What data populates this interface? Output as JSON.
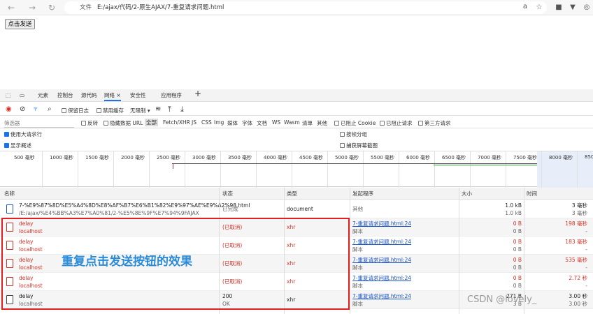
{
  "browser": {
    "file_label": "文件",
    "url": "E:/ajax/代码/2-原生AJAX/7-重复请求问题.html"
  },
  "page": {
    "send_button": "点击发送"
  },
  "devtools": {
    "tabs": [
      "元素",
      "控制台",
      "源代码",
      "网络",
      "安全性",
      "应用程序"
    ],
    "active_tab": "网络",
    "toolbar": {
      "preserve_log": "保留日志",
      "disable_cache": "禁用缓存",
      "throttle": "无限制"
    },
    "filter": {
      "placeholder": "筛选器",
      "invert": "反转",
      "hide_data_url": "隐藏数据 URL",
      "types": [
        "全部",
        "Fetch/XHR",
        "JS",
        "CSS",
        "Img",
        "媒体",
        "字体",
        "文档",
        "WS",
        "Wasm",
        "清单",
        "其他"
      ],
      "blocked_cookies": "已阻止 Cookie",
      "blocked_requests": "已阻止请求",
      "third_party": "第三方请求"
    },
    "options": {
      "large_rows": "使用大请求行",
      "overview": "显示概述",
      "group_by_frame": "按帧分组",
      "capture_screenshots": "捕获屏幕截图"
    },
    "timeline_ticks": [
      "500 毫秒",
      "1000 毫秒",
      "1500 毫秒",
      "2000 毫秒",
      "2500 毫秒",
      "3000 毫秒",
      "3500 毫秒",
      "4000 毫秒",
      "4500 毫秒",
      "5000 毫秒",
      "5500 毫秒",
      "6000 毫秒",
      "6500 毫秒",
      "7000 毫秒",
      "7500 毫秒",
      "8000 毫秒",
      "8500"
    ],
    "columns": {
      "name": "名称",
      "status": "状态",
      "type": "类型",
      "initiator": "发起程序",
      "size": "大小",
      "time": "时间"
    },
    "rows": [
      {
        "name": "7-%E9%87%8D%E5%A4%8D%E8%AF%B7%E6%B1%82%E9%97%AE%E9%A2%98.html",
        "sub": "/E:/ajax/%E4%BB%A3%E7%A0%81/2-%E5%8E%9F%E7%94%9FAJAX",
        "status": "已完成",
        "status2": "",
        "type": "document",
        "initiator": "其他",
        "initiator2": "",
        "size1": "1.0 kB",
        "size2": "1.0 kB",
        "time1": "3 毫秒",
        "time2": "3 毫秒"
      },
      {
        "name": "delay",
        "sub": "localhost",
        "status": "(已取消)",
        "status2": "",
        "type": "xhr",
        "initiator": "7-重复请求问题.html:24",
        "initiator2": "脚本",
        "size1": "0 B",
        "size2": "0 B",
        "time1": "198 毫秒",
        "time2": "-"
      },
      {
        "name": "delay",
        "sub": "localhost",
        "status": "(已取消)",
        "status2": "",
        "type": "xhr",
        "initiator": "7-重复请求问题.html:24",
        "initiator2": "脚本",
        "size1": "0 B",
        "size2": "0 B",
        "time1": "183 毫秒",
        "time2": "-"
      },
      {
        "name": "delay",
        "sub": "localhost",
        "status": "(已取消)",
        "status2": "",
        "type": "xhr",
        "initiator": "7-重复请求问题.html:24",
        "initiator2": "脚本",
        "size1": "0 B",
        "size2": "0 B",
        "time1": "535 毫秒",
        "time2": "-"
      },
      {
        "name": "delay",
        "sub": "localhost",
        "status": "(已取消)",
        "status2": "",
        "type": "xhr",
        "initiator": "7-重复请求问题.html:24",
        "initiator2": "脚本",
        "size1": "0 B",
        "size2": "0 B",
        "time1": "2.72 秒",
        "time2": "-"
      },
      {
        "name": "delay",
        "sub": "localhost",
        "status": "200",
        "status2": "OK",
        "type": "xhr",
        "initiator": "7-重复请求问题.html:24",
        "initiator2": "脚本",
        "size1": "271 B",
        "size2": "3 B",
        "time1": "3.00 秒",
        "time2": "3.00 秒"
      }
    ]
  },
  "annotation": "重复点击发送按钮的效果",
  "watermark": "CSDN @lovely_"
}
